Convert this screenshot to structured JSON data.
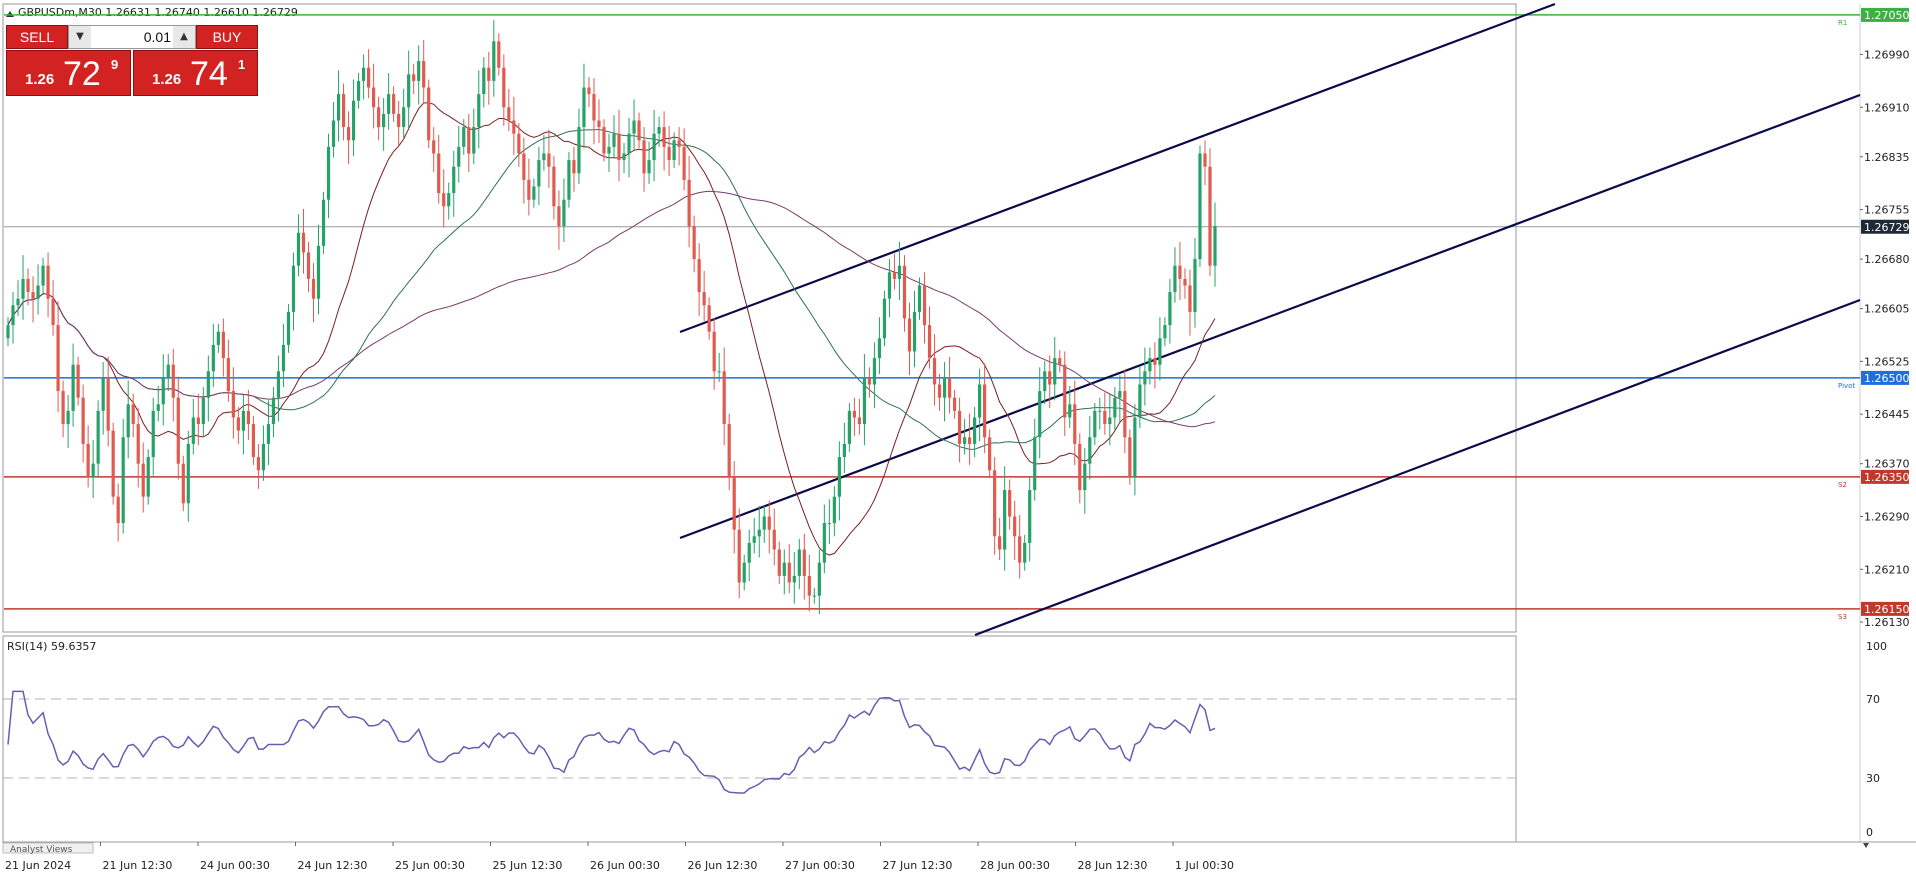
{
  "chart_header": {
    "text": "GBPUSDm,M30  1.26631 1.26740 1.26610 1.26729"
  },
  "trade_panel": {
    "sell_label": "SELL",
    "buy_label": "BUY",
    "lot_value": "0.01",
    "sell_price_small": "1.26",
    "sell_price_big": "72",
    "sell_price_sup": "9",
    "buy_price_small": "1.26",
    "buy_price_big": "74",
    "buy_price_sup": "1"
  },
  "price_axis": {
    "labels": [
      "1.26990",
      "1.26910",
      "1.26835",
      "1.26755",
      "1.26680",
      "1.26605",
      "1.26525",
      "1.26445",
      "1.26370",
      "1.26290",
      "1.26210",
      "1.26130"
    ],
    "range": [
      1.26118,
      1.27065
    ]
  },
  "horizontal_levels": [
    {
      "price": 1.2705,
      "label": "1.27050",
      "color": "#3cb043",
      "tag_name": "R1"
    },
    {
      "price": 1.265,
      "label": "1.26500",
      "color": "#1e6fd9",
      "tag_name": "Pivot"
    },
    {
      "price": 1.2635,
      "label": "1.26350",
      "color": "#c0392b",
      "tag_name": "S2"
    },
    {
      "price": 1.2615,
      "label": "1.26150",
      "color": "#c0392b",
      "tag_name": "S3"
    }
  ],
  "current_price": {
    "price": 1.26729,
    "label": "1.26729"
  },
  "rsi": {
    "title": "RSI(14) 59.6357",
    "levels": [
      "100",
      "70",
      "30",
      "0"
    ]
  },
  "time_axis": {
    "labels": [
      "21 Jun 2024",
      "21 Jun 12:30",
      "24 Jun 00:30",
      "24 Jun 12:30",
      "25 Jun 00:30",
      "25 Jun 12:30",
      "26 Jun 00:30",
      "26 Jun 12:30",
      "27 Jun 00:30",
      "27 Jun 12:30",
      "28 Jun 00:30",
      "28 Jun 12:30",
      "1 Jul 00:30"
    ]
  },
  "bottom_tab": {
    "label": "Analyst Views"
  },
  "colors": {
    "bull": "#26a269",
    "bear": "#e05a4f",
    "channel": "#0b0b4a",
    "rsi_line": "#6b5bb3",
    "ma1": "#7a1f1f",
    "ma2": "#2f6f5a",
    "ma3": "#7a3b6b"
  },
  "chart_data": {
    "type": "candlestick",
    "symbol": "GBPUSDm",
    "timeframe": "M30",
    "ohlc_header": {
      "open": 1.26631,
      "high": 1.2674,
      "low": 1.2661,
      "close": 1.26729
    },
    "y_range": [
      1.26118,
      1.27065
    ],
    "closes": [
      1.2658,
      1.2661,
      1.2662,
      1.2665,
      1.2663,
      1.2662,
      1.2664,
      1.2667,
      1.2662,
      1.2658,
      1.2648,
      1.2643,
      1.2645,
      1.2652,
      1.2647,
      1.264,
      1.2635,
      1.2637,
      1.2645,
      1.265,
      1.2642,
      1.2632,
      1.2628,
      1.2641,
      1.2646,
      1.2643,
      1.2637,
      1.2632,
      1.2638,
      1.2645,
      1.2646,
      1.265,
      1.2652,
      1.2647,
      1.2637,
      1.2631,
      1.264,
      1.2644,
      1.2643,
      1.2647,
      1.2651,
      1.2655,
      1.2657,
      1.2653,
      1.2648,
      1.2644,
      1.2642,
      1.2645,
      1.2643,
      1.2638,
      1.2636,
      1.264,
      1.2643,
      1.2647,
      1.2651,
      1.2655,
      1.266,
      1.2667,
      1.2672,
      1.2669,
      1.2665,
      1.2662,
      1.267,
      1.2677,
      1.2685,
      1.2689,
      1.2693,
      1.2688,
      1.2686,
      1.2692,
      1.2695,
      1.2697,
      1.2694,
      1.2691,
      1.2688,
      1.269,
      1.2693,
      1.269,
      1.2688,
      1.2691,
      1.2696,
      1.2695,
      1.2698,
      1.2694,
      1.2686,
      1.2684,
      1.2678,
      1.2676,
      1.2678,
      1.2682,
      1.2685,
      1.2688,
      1.2684,
      1.2688,
      1.2693,
      1.2697,
      1.2695,
      1.2701,
      1.2697,
      1.2691,
      1.2689,
      1.2687,
      1.2684,
      1.268,
      1.2677,
      1.2679,
      1.2683,
      1.2684,
      1.2682,
      1.2676,
      1.2673,
      1.2677,
      1.2683,
      1.2681,
      1.2688,
      1.2694,
      1.2693,
      1.2689,
      1.2688,
      1.2684,
      1.2685,
      1.2687,
      1.2683,
      1.2684,
      1.2687,
      1.2689,
      1.2686,
      1.2681,
      1.2683,
      1.2687,
      1.2688,
      1.2685,
      1.2683,
      1.2686,
      1.2685,
      1.268,
      1.2673,
      1.2668,
      1.2663,
      1.2661,
      1.2657,
      1.2651,
      1.2651,
      1.2643,
      1.2635,
      1.2627,
      1.2619,
      1.2622,
      1.2625,
      1.2626,
      1.2627,
      1.2629,
      1.2627,
      1.2624,
      1.262,
      1.2622,
      1.2619,
      1.262,
      1.2624,
      1.262,
      1.2617,
      1.2617,
      1.2622,
      1.2628,
      1.2628,
      1.2632,
      1.2638,
      1.264,
      1.2645,
      1.2644,
      1.2643,
      1.265,
      1.2649,
      1.2653,
      1.2656,
      1.2662,
      1.2666,
      1.2665,
      1.2667,
      1.2659,
      1.2654,
      1.266,
      1.2664,
      1.2658,
      1.2653,
      1.2649,
      1.2647,
      1.265,
      1.2647,
      1.2645,
      1.264,
      1.2641,
      1.264,
      1.2644,
      1.2649,
      1.2641,
      1.2636,
      1.2626,
      1.2624,
      1.2633,
      1.2629,
      1.2626,
      1.2622,
      1.2625,
      1.2633,
      1.2641,
      1.2648,
      1.2651,
      1.2649,
      1.2653,
      1.2652,
      1.2644,
      1.2646,
      1.264,
      1.2633,
      1.2637,
      1.2641,
      1.2645,
      1.2645,
      1.2643,
      1.2644,
      1.2647,
      1.2648,
      1.2641,
      1.2635,
      1.2644,
      1.2649,
      1.2651,
      1.2653,
      1.2652,
      1.2656,
      1.2658,
      1.2663,
      1.2667,
      1.2665,
      1.2664,
      1.266,
      1.2668,
      1.2684,
      1.2682,
      1.2667,
      1.2673
    ]
  }
}
